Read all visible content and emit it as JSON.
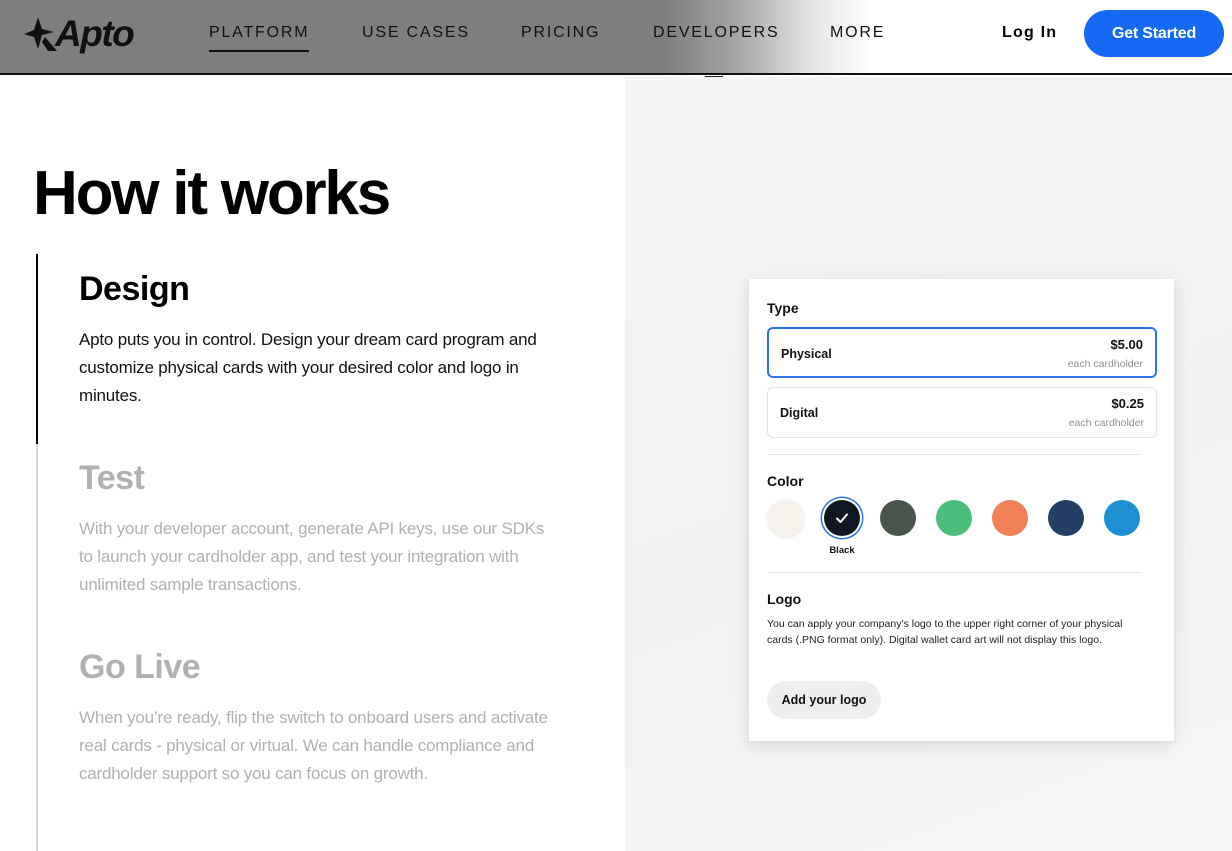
{
  "header": {
    "logo_text": "Apto",
    "nav": [
      "PLATFORM",
      "USE CASES",
      "PRICING",
      "DEVELOPERS",
      "MORE"
    ],
    "active_nav": "PLATFORM",
    "login_label": "Log In",
    "cta_label": "Get Started",
    "cta_color": "#1669f2"
  },
  "main": {
    "heading": "How it works",
    "steps": [
      {
        "title": "Design",
        "body": "Apto puts you in control. Design your dream card program and customize physical cards with your desired color and logo in minutes.",
        "active": true
      },
      {
        "title": "Test",
        "body": "With your developer account, generate API keys, use our SDKs to launch your cardholder app, and test your integration with unlimited sample transactions.",
        "active": false
      },
      {
        "title": "Go Live",
        "body": "When you’re ready, flip the switch to onboard users and activate real cards - physical or virtual. We can handle compliance and cardholder support so you can focus on growth.",
        "active": false
      }
    ]
  },
  "card_config": {
    "type_label": "Type",
    "options": [
      {
        "name": "Physical",
        "price": "$5.00",
        "sub": "each cardholder",
        "selected": true
      },
      {
        "name": "Digital",
        "price": "$0.25",
        "sub": "each cardholder",
        "selected": false
      }
    ],
    "color_label": "Color",
    "colors": [
      "#f6f3ec",
      "#111722",
      "#4a564c",
      "#4cbe7c",
      "#f08055",
      "#243f66",
      "#1f8fd3"
    ],
    "selected_color_name": "Black",
    "selected_color_index": 1,
    "logo_label": "Logo",
    "logo_desc": "You can apply your company’s logo to the upper right corner of your physical cards (.PNG format only). Digital wallet card art will not display this logo.",
    "logo_button": "Add your logo",
    "accent_color": "#2f73e8"
  }
}
